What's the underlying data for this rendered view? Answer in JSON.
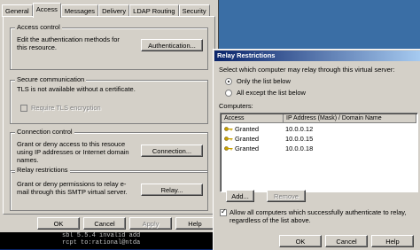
{
  "props_dialog": {
    "tabs": [
      "General",
      "Access",
      "Messages",
      "Delivery",
      "LDAP Routing",
      "Security"
    ],
    "access_control": {
      "title": "Access control",
      "text": "Edit the authentication methods for this resource.",
      "button": "Authentication..."
    },
    "secure_comm": {
      "title": "Secure communication",
      "text": "TLS is not available without a certificate.",
      "require_tls": "Require TLS encryption"
    },
    "connection_control": {
      "title": "Connection control",
      "text": "Grant or deny access to this resouce using IP addresses or Internet domain names.",
      "button": "Connection..."
    },
    "relay_restrictions": {
      "title": "Relay restrictions",
      "text": "Grant or deny permissions to relay e-mail through this SMTP virtual server.",
      "button": "Relay..."
    },
    "footer": {
      "ok": "OK",
      "cancel": "Cancel",
      "apply": "Apply",
      "help": "Help"
    }
  },
  "terminal": {
    "line1": "sbl 5.5.4 invalid add",
    "line2": "rcpt to:rational@ntda"
  },
  "relay_dialog": {
    "title": "Relay Restrictions",
    "instruction": "Select which computer may relay through this virtual server:",
    "radio_only": "Only the list below",
    "radio_all_except": "All except the list below",
    "computers_label": "Computers:",
    "columns": [
      "Access",
      "IP Address (Mask) / Domain Name"
    ],
    "rows": [
      {
        "access": "Granted",
        "ip": "10.0.0.12"
      },
      {
        "access": "Granted",
        "ip": "10.0.0.15"
      },
      {
        "access": "Granted",
        "ip": "10.0.0.18"
      }
    ],
    "add": "Add...",
    "remove": "Remove",
    "allow_all": "Allow all computers which successfully authenticate to relay, regardless of the list above.",
    "ok": "OK",
    "cancel": "Cancel",
    "help": "Help"
  }
}
